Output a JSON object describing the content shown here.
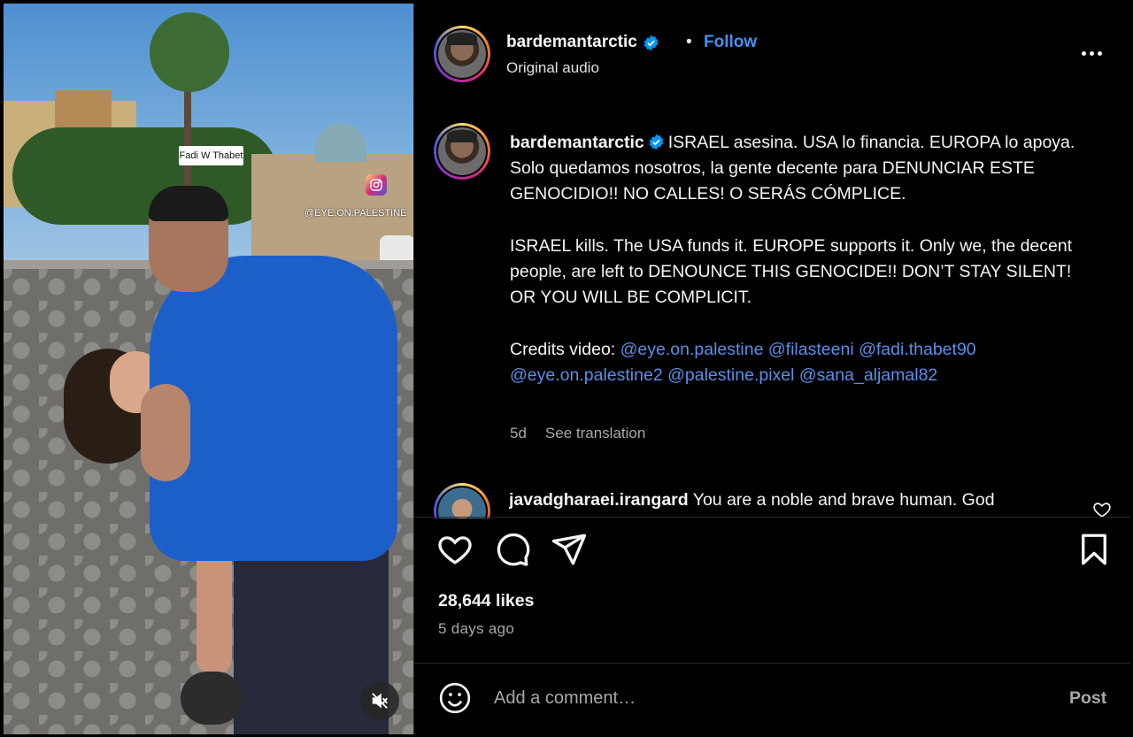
{
  "media": {
    "tag_label": "Fadi W Thabet",
    "watermark_handle": "@EYE.ON.PALESTINE"
  },
  "post": {
    "author": "bardemantarctic",
    "follow_label": "Follow",
    "separator": "•",
    "audio_label": "Original audio",
    "verified_color": "#0095f6",
    "link_color": "#4193ef"
  },
  "caption": {
    "author": "bardemantarctic",
    "spanish": "ISRAEL asesina. USA lo financia. EUROPA lo apoya. Solo quedamos nosotros, la gente decente para DENUNCIAR ESTE GENOCIDIO!! NO CALLES! O SERÁS CÓMPLICE.",
    "english": "ISRAEL kills. The USA funds it. EUROPE supports it. Only we, the decent people, are left to DENOUNCE THIS GENOCIDE!! DON’T STAY SILENT! OR YOU WILL BE COMPLICIT.",
    "credits_prefix": "Credits video:",
    "mentions": [
      "@eye.on.palestine",
      "@filasteeni",
      "@fadi.thabet90",
      "@eye.on.palestine2",
      "@palestine.pixel",
      "@sana_aljamal82"
    ],
    "age": "5d",
    "see_translation": "See translation"
  },
  "comment": {
    "author": "javadgharaei.irangard",
    "text": "You are a noble and brave human. God"
  },
  "stats": {
    "likes": "28,644 likes",
    "posted": "5 days ago"
  },
  "composer": {
    "placeholder": "Add a comment…",
    "post_label": "Post"
  },
  "icons": {
    "like": "heart-icon",
    "comment": "comment-bubble-icon",
    "share": "paper-plane-icon",
    "save": "bookmark-icon",
    "emoji": "smiley-icon",
    "mute": "muted-speaker-icon",
    "more": "more-options-icon"
  }
}
